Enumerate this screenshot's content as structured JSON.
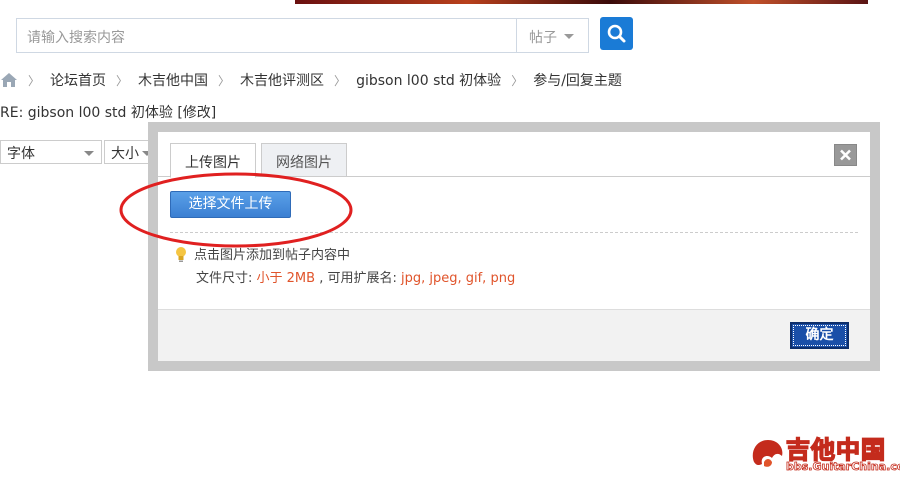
{
  "search": {
    "placeholder": "请输入搜索内容",
    "type_select": "帖子"
  },
  "breadcrumb": [
    "论坛首页",
    "木吉他中国",
    "木吉他评测区",
    "gibson l00 std 初体验",
    "参与/回复主题"
  ],
  "post_title": "RE: gibson l00 std 初体验",
  "edit_link": "[修改]",
  "toolbar": {
    "font_label": "字体",
    "size_label": "大小"
  },
  "dialog": {
    "tabs": [
      "上传图片",
      "网络图片"
    ],
    "upload_button": "选择文件上传",
    "tip_line1": "点击图片添加到帖子内容中",
    "size_prefix": "文件尺寸: ",
    "size_limit": "小于  2MB",
    "ext_prefix": " , 可用扩展名: ",
    "extensions": "jpg, jpeg, gif, png",
    "confirm": "确定"
  },
  "watermark": {
    "name": "吉他中国",
    "url": "bbs.GuitarChina.com"
  },
  "colors": {
    "accent": "#1a7bd6",
    "link_red": "#e0542b",
    "annotation_red": "#e02020",
    "confirm": "#1a4fa8"
  },
  "icons": [
    "home-icon",
    "search-icon",
    "close-icon",
    "lightbulb-icon",
    "guitarchina-logo"
  ]
}
